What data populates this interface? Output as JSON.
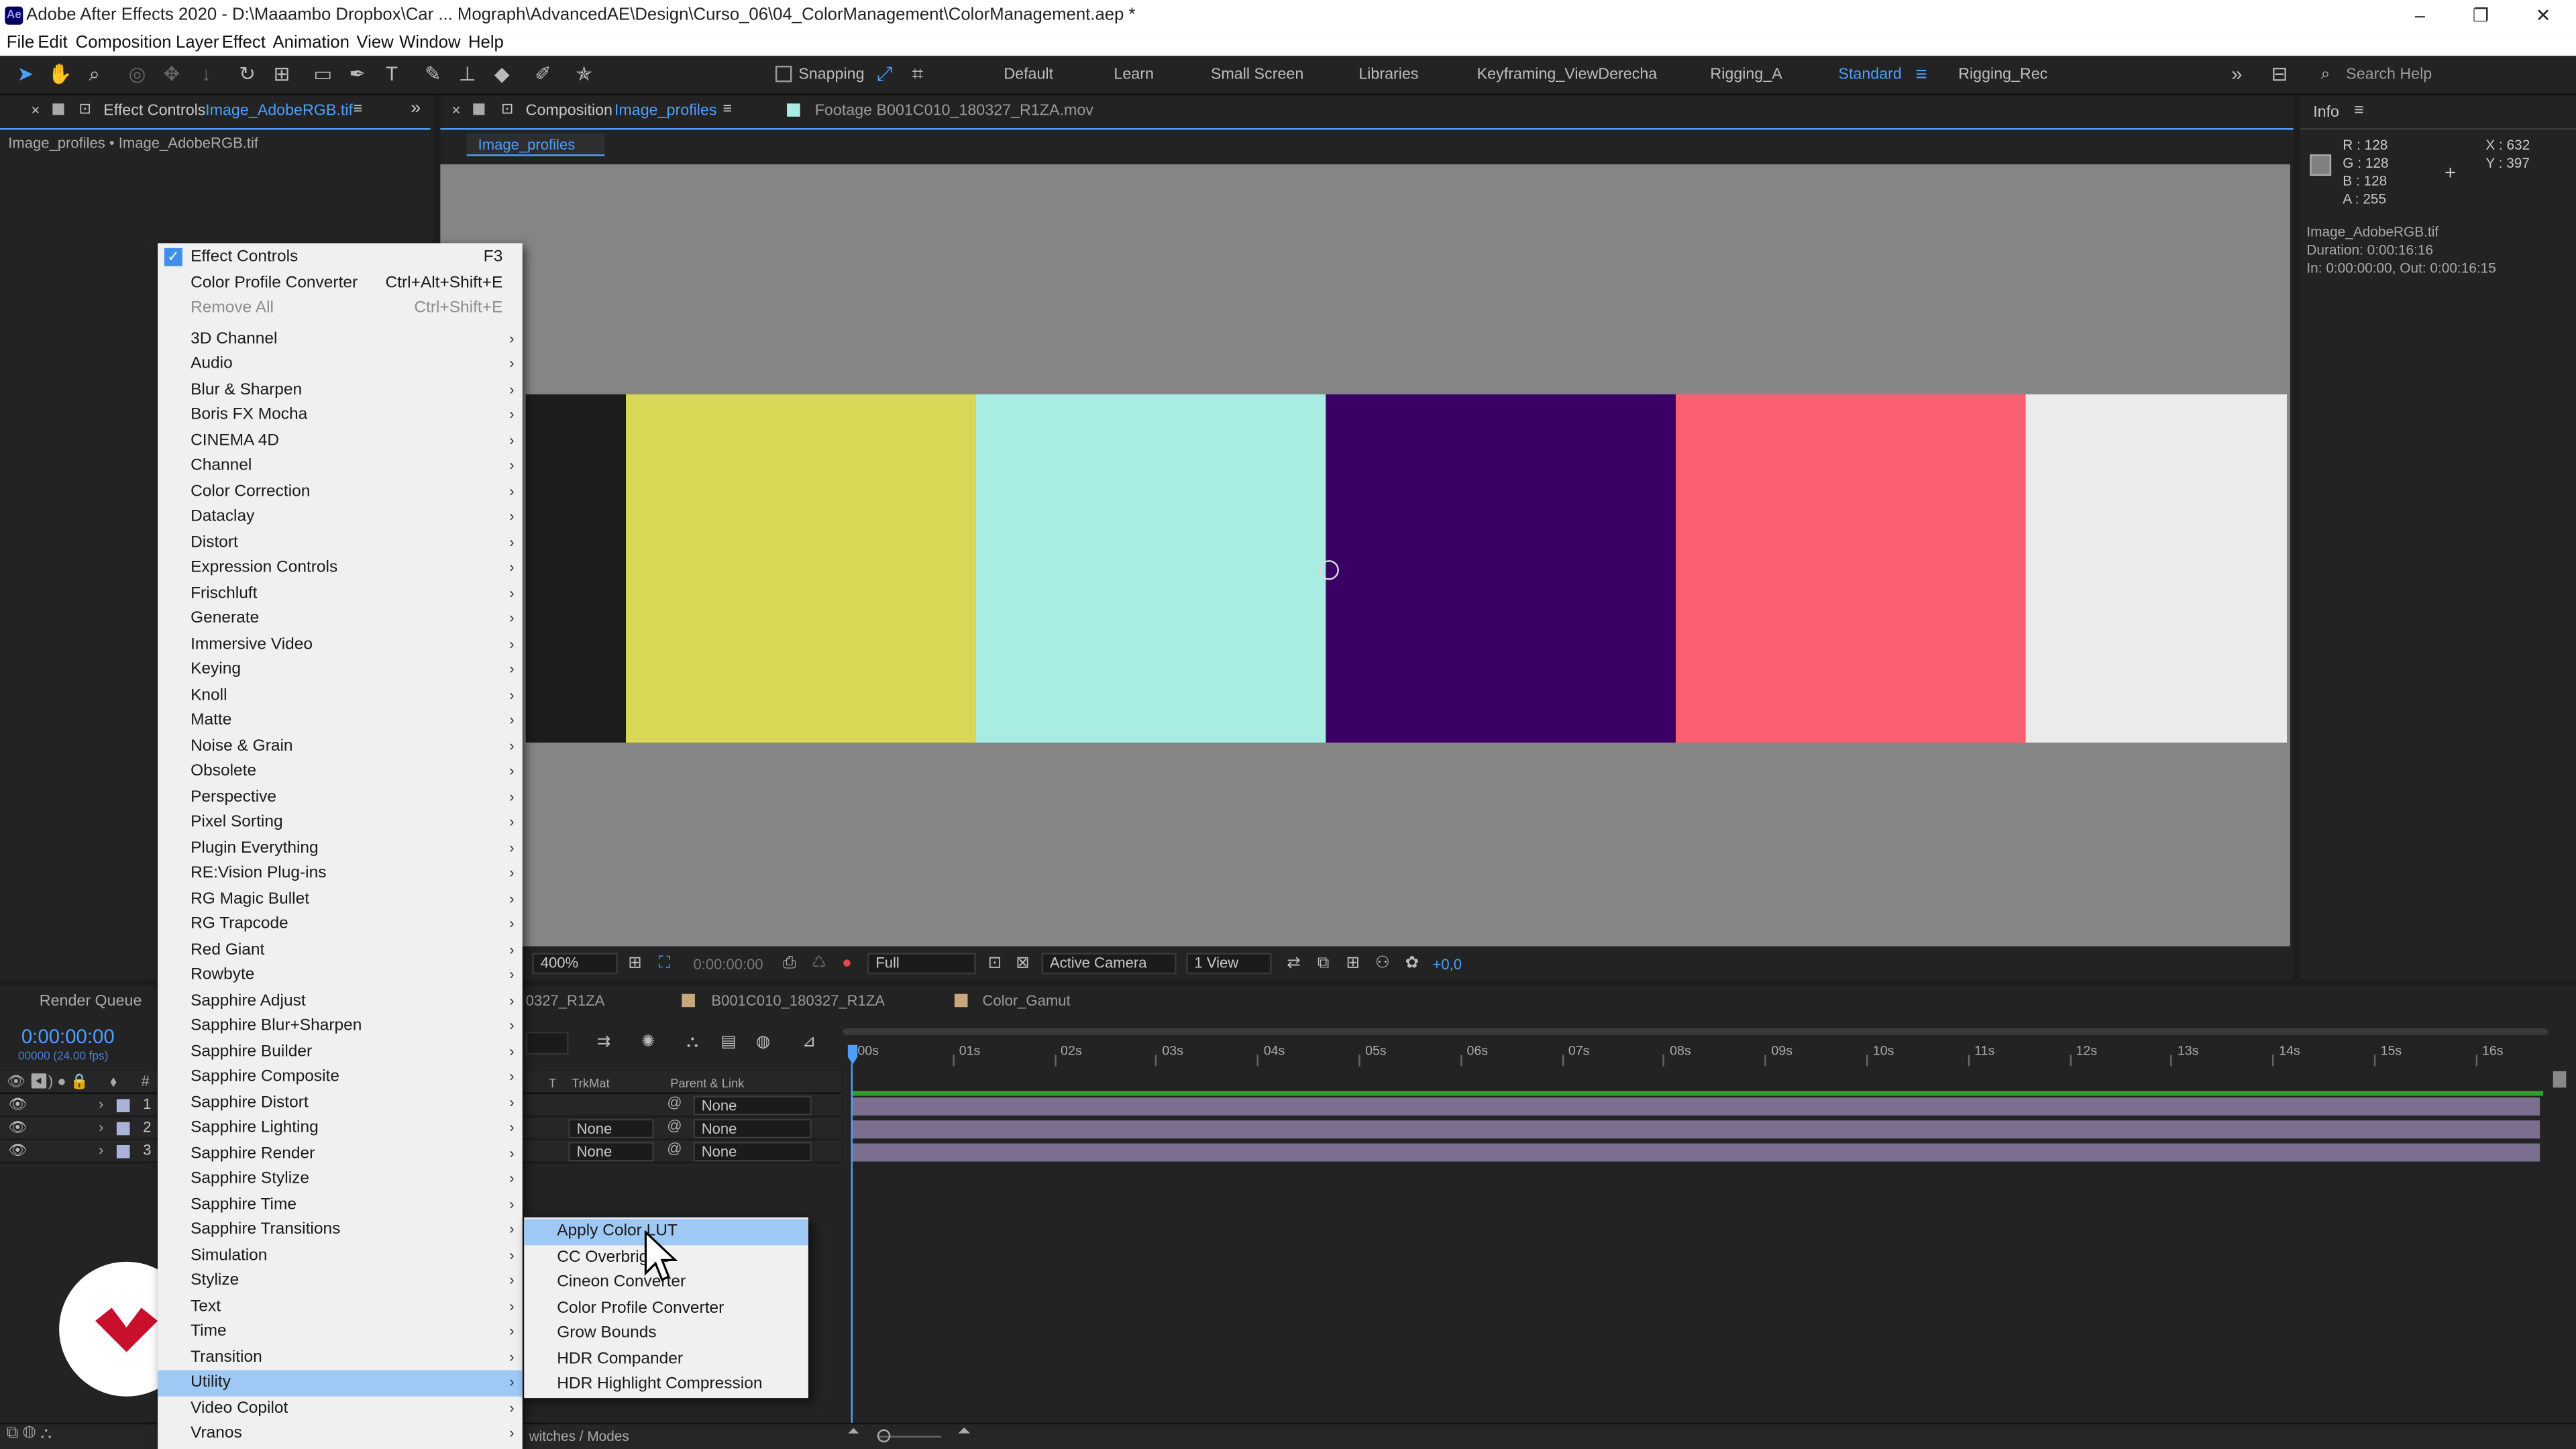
{
  "app": {
    "icon_text": "Ae",
    "title": "Adobe After Effects 2020 - D:\\Maaambo Dropbox\\Car ... Mograph\\AdvancedAE\\Design\\Curso_06\\04_ColorManagement\\ColorManagement.aep *"
  },
  "window_controls": {
    "minimize": "–",
    "restore": "❐",
    "close": "✕"
  },
  "menubar": [
    "File",
    "Edit",
    "Composition",
    "Layer",
    "Effect",
    "Animation",
    "View",
    "Window",
    "Help"
  ],
  "toolbar": {
    "snapping_label": "Snapping",
    "workspaces": [
      "Default",
      "Learn",
      "Small Screen",
      "Libraries",
      "Keyframing_ViewDerecha",
      "Rigging_A",
      "Standard",
      "Rigging_Rec"
    ],
    "active_workspace": "Standard",
    "search_placeholder": "Search Help"
  },
  "effect_controls": {
    "tab_prefix": "Effect Controls",
    "tab_layer": "Image_AdobeRGB.tif",
    "breadcrumb": "Image_profiles • Image_AdobeRGB.tif"
  },
  "composition": {
    "tab_prefix": "Composition",
    "tab_name": "Image_profiles",
    "footage_tab": "Footage  B001C010_180327_R1ZA.mov",
    "sub_tab": "Image_profiles",
    "colors": [
      "#1c1c1c",
      "#d8d856",
      "#a8ece4",
      "#3a0066",
      "#fa6072",
      "#ebebeb"
    ]
  },
  "viewer_bar": {
    "zoom": "400%",
    "timecode": "0:00:00:00",
    "resolution": "Full",
    "camera": "Active Camera",
    "views": "1 View",
    "exposure": "+0,0"
  },
  "info": {
    "title": "Info",
    "r": "R :  128",
    "g": "G :  128",
    "b": "B :  128",
    "a": "A :  255",
    "x": "X : 632",
    "y": "Y : 397",
    "file": "Image_AdobeRGB.tif",
    "duration": "Duration: 0:00:16:16",
    "inout": "In: 0:00:00:00, Out: 0:00:16:15"
  },
  "timeline": {
    "render_queue": "Render Queue",
    "tabs": [
      "0327_R1ZA",
      "B001C010_180327_R1ZA",
      "Color_Gamut"
    ],
    "timecode": "0:00:00:00",
    "frames": "00000 (24.00 fps)",
    "col_trkmat": "TrkMat",
    "col_parent": "Parent & Link",
    "layer_nums": [
      "1",
      "2",
      "3"
    ],
    "trkmat_values": [
      "",
      "None",
      "None"
    ],
    "parent_values": [
      "None",
      "None",
      "None"
    ],
    "ruler": [
      "00s",
      "01s",
      "02s",
      "03s",
      "04s",
      "05s",
      "06s",
      "07s",
      "08s",
      "09s",
      "10s",
      "11s",
      "12s",
      "13s",
      "14s",
      "15s",
      "16s"
    ],
    "toggle_label": "witches / Modes"
  },
  "context_menu": {
    "items": [
      {
        "label": "Effect Controls",
        "shortcut": "F3",
        "checked": true
      },
      {
        "label": "Color Profile Converter",
        "shortcut": "Ctrl+Alt+Shift+E"
      },
      {
        "label": "Remove All",
        "shortcut": "Ctrl+Shift+E",
        "disabled": true
      },
      {
        "label": "3D Channel",
        "sub": true
      },
      {
        "label": "Audio",
        "sub": true
      },
      {
        "label": "Blur & Sharpen",
        "sub": true
      },
      {
        "label": "Boris FX Mocha",
        "sub": true
      },
      {
        "label": "CINEMA 4D",
        "sub": true
      },
      {
        "label": "Channel",
        "sub": true
      },
      {
        "label": "Color Correction",
        "sub": true
      },
      {
        "label": "Dataclay",
        "sub": true
      },
      {
        "label": "Distort",
        "sub": true
      },
      {
        "label": "Expression Controls",
        "sub": true
      },
      {
        "label": "Frischluft",
        "sub": true
      },
      {
        "label": "Generate",
        "sub": true
      },
      {
        "label": "Immersive Video",
        "sub": true
      },
      {
        "label": "Keying",
        "sub": true
      },
      {
        "label": "Knoll",
        "sub": true
      },
      {
        "label": "Matte",
        "sub": true
      },
      {
        "label": "Noise & Grain",
        "sub": true
      },
      {
        "label": "Obsolete",
        "sub": true
      },
      {
        "label": "Perspective",
        "sub": true
      },
      {
        "label": "Pixel Sorting",
        "sub": true
      },
      {
        "label": "Plugin Everything",
        "sub": true
      },
      {
        "label": "RE:Vision Plug-ins",
        "sub": true
      },
      {
        "label": "RG Magic Bullet",
        "sub": true
      },
      {
        "label": "RG Trapcode",
        "sub": true
      },
      {
        "label": "Red Giant",
        "sub": true
      },
      {
        "label": "Rowbyte",
        "sub": true
      },
      {
        "label": "Sapphire Adjust",
        "sub": true
      },
      {
        "label": "Sapphire Blur+Sharpen",
        "sub": true
      },
      {
        "label": "Sapphire Builder",
        "sub": true
      },
      {
        "label": "Sapphire Composite",
        "sub": true
      },
      {
        "label": "Sapphire Distort",
        "sub": true
      },
      {
        "label": "Sapphire Lighting",
        "sub": true
      },
      {
        "label": "Sapphire Render",
        "sub": true
      },
      {
        "label": "Sapphire Stylize",
        "sub": true
      },
      {
        "label": "Sapphire Time",
        "sub": true
      },
      {
        "label": "Sapphire Transitions",
        "sub": true
      },
      {
        "label": "Simulation",
        "sub": true
      },
      {
        "label": "Stylize",
        "sub": true
      },
      {
        "label": "Text",
        "sub": true
      },
      {
        "label": "Time",
        "sub": true
      },
      {
        "label": "Transition",
        "sub": true
      },
      {
        "label": "Utility",
        "sub": true,
        "highlighted": true
      },
      {
        "label": "Video Copilot",
        "sub": true
      },
      {
        "label": "Vranos",
        "sub": true
      }
    ]
  },
  "submenu": {
    "items": [
      {
        "label": "Apply Color LUT",
        "highlighted": true
      },
      {
        "label": "CC Overbrights"
      },
      {
        "label": "Cineon Converter"
      },
      {
        "label": "Color Profile Converter"
      },
      {
        "label": "Grow Bounds"
      },
      {
        "label": "HDR Compander"
      },
      {
        "label": "HDR Highlight Compression"
      }
    ]
  },
  "theme": {
    "accent": "#4c9fff",
    "menu_bg": "#f0f0f0",
    "highlight": "#9fc9f5",
    "layer_bar": "#7c6e8e",
    "logo_red": "#c8102e"
  }
}
